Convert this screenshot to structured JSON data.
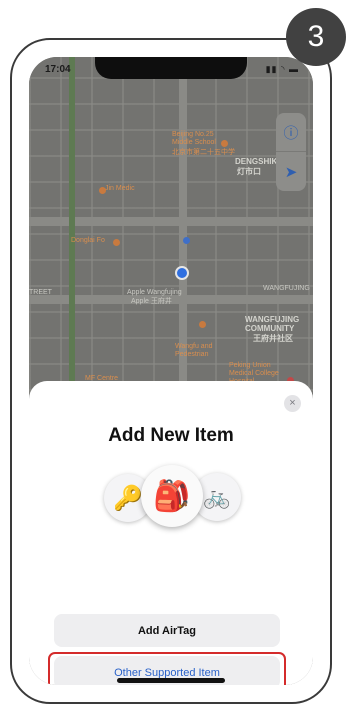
{
  "step": {
    "number": "3"
  },
  "status_bar": {
    "time": "17:04",
    "icons": "▮▮ ◝ ▬"
  },
  "map": {
    "labels": {
      "school": "Beijing No.25\nMiddle School",
      "school_cn": "北京市第二十五中学",
      "dengshi": "DENGSHIK",
      "dengshi_cn": "灯市口",
      "jin_medic": "Jin Medic",
      "donglai": "Donglai Fo",
      "wangfujing": "WANGFUJING",
      "tree": "TREET",
      "apple": "Apple Wangfujing",
      "apple_cn": "Apple 王府井",
      "community": "WANGFUJING\nCOMMUNITY",
      "community_cn": "王府井社区",
      "peking": "Peking Union\nMedical College\nHospital",
      "center": "MF Centre",
      "wanglu": "Wangfu and\nPedestrian"
    }
  },
  "sheet": {
    "title": "Add New Item",
    "close": "×",
    "items": {
      "left": "🔑",
      "center": "🎒",
      "right": "🚲"
    },
    "add_airtag": "Add AirTag",
    "other_item": "Other Supported Item"
  },
  "colors": {
    "highlight": "#d42b2b",
    "link_blue": "#2a62c9",
    "badge": "#414141"
  }
}
